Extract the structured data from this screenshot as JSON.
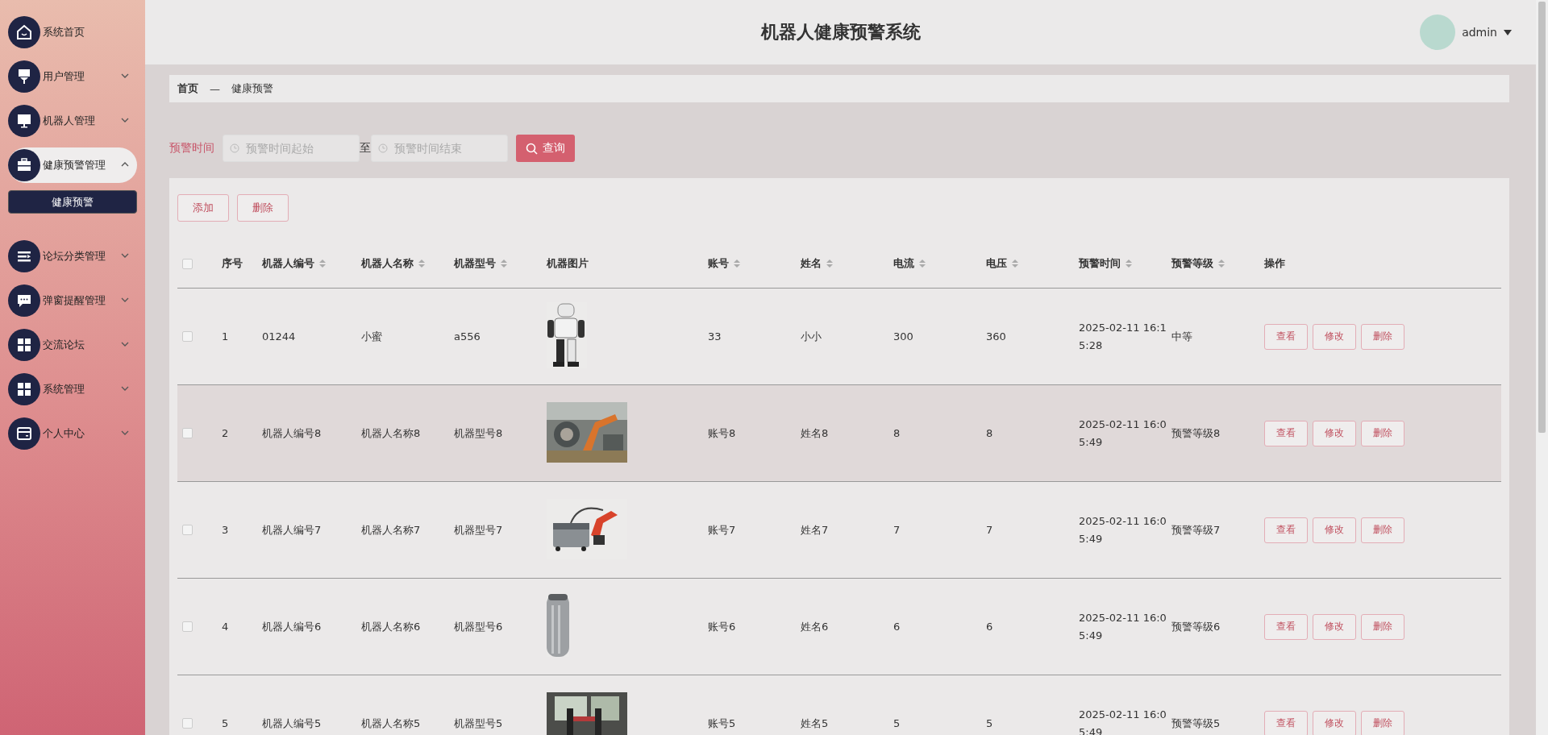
{
  "sidebar": {
    "items": [
      {
        "label": "系统首页"
      },
      {
        "label": "用户管理",
        "expanded": false
      },
      {
        "label": "机器人管理",
        "expanded": false
      },
      {
        "label": "健康预警管理",
        "expanded": true,
        "children": [
          {
            "label": "健康预警",
            "selected": true
          }
        ]
      },
      {
        "label": "论坛分类管理",
        "expanded": false
      },
      {
        "label": "弹窗提醒管理",
        "expanded": false
      },
      {
        "label": "交流论坛",
        "expanded": false
      },
      {
        "label": "系统管理",
        "expanded": false
      },
      {
        "label": "个人中心",
        "expanded": false
      }
    ]
  },
  "header": {
    "title": "机器人健康预警系统",
    "user": "admin"
  },
  "breadcrumb": {
    "items": [
      "首页",
      "健康预警"
    ],
    "separator": "—"
  },
  "filter": {
    "label": "预警时间",
    "start": {
      "placeholder": "预警时间起始"
    },
    "between": "至",
    "end": {
      "placeholder": "预警时间结束"
    },
    "button": "查询"
  },
  "toolbar": [
    "添加",
    "删除"
  ],
  "table": {
    "select_all": {
      "checked": false
    },
    "columns": [
      {
        "label": "序号",
        "sortable": false
      },
      {
        "label": "机器人编号",
        "sortable": true
      },
      {
        "label": "机器人名称",
        "sortable": true
      },
      {
        "label": "机器型号",
        "sortable": true
      },
      {
        "label": "机器图片",
        "sortable": false
      },
      {
        "label": "账号",
        "sortable": true
      },
      {
        "label": "姓名",
        "sortable": true
      },
      {
        "label": "电流",
        "sortable": true
      },
      {
        "label": "电压",
        "sortable": true
      },
      {
        "label": "预警时间",
        "sortable": true
      },
      {
        "label": "预警等级",
        "sortable": true
      },
      {
        "label": "操作",
        "sortable": false
      }
    ],
    "rows": [
      {
        "checked": false,
        "hovered": false,
        "cells": [
          "1",
          "01244",
          "小蜜",
          "a556",
          {
            "kind": "picture"
          },
          "33",
          "小小",
          "300",
          "360",
          "2025-02-11 16:15:28",
          "中等",
          [
            "查看",
            "修改",
            "删除"
          ]
        ]
      },
      {
        "checked": false,
        "hovered": true,
        "cells": [
          "2",
          "机器人编号8",
          "机器人名称8",
          "机器型号8",
          {
            "kind": "picture"
          },
          "账号8",
          "姓名8",
          "8",
          "8",
          "2025-02-11 16:05:49",
          "预警等级8",
          [
            "查看",
            "修改",
            "删除"
          ]
        ]
      },
      {
        "checked": false,
        "hovered": false,
        "cells": [
          "3",
          "机器人编号7",
          "机器人名称7",
          "机器型号7",
          {
            "kind": "picture"
          },
          "账号7",
          "姓名7",
          "7",
          "7",
          "2025-02-11 16:05:49",
          "预警等级7",
          [
            "查看",
            "修改",
            "删除"
          ]
        ]
      },
      {
        "checked": false,
        "hovered": false,
        "cells": [
          "4",
          "机器人编号6",
          "机器人名称6",
          "机器型号6",
          {
            "kind": "picture"
          },
          "账号6",
          "姓名6",
          "6",
          "6",
          "2025-02-11 16:05:49",
          "预警等级6",
          [
            "查看",
            "修改",
            "删除"
          ]
        ]
      },
      {
        "checked": false,
        "hovered": false,
        "cells": [
          "5",
          "机器人编号5",
          "机器人名称5",
          "机器型号5",
          {
            "kind": "picture"
          },
          "账号5",
          "姓名5",
          "5",
          "5",
          "2025-02-11 16:05:49",
          "预警等级5",
          [
            "查看",
            "修改",
            "删除"
          ]
        ]
      }
    ]
  }
}
